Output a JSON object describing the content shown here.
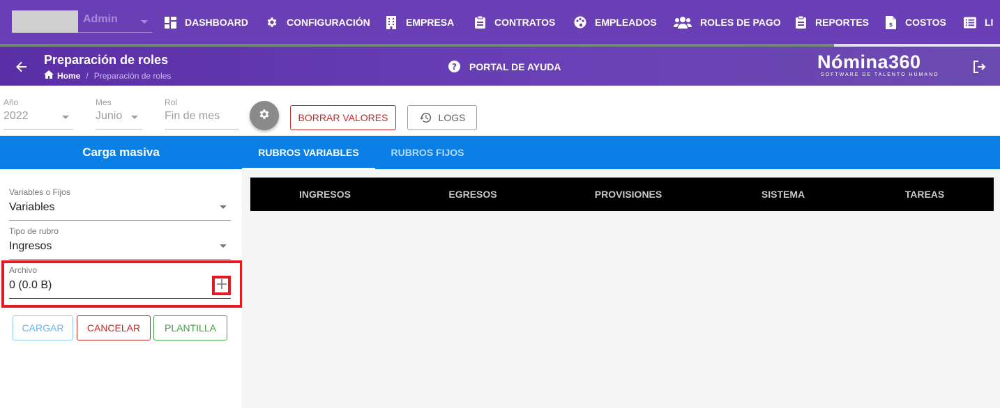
{
  "topnav": {
    "user_label": "Admin",
    "items": [
      {
        "label": "DASHBOARD",
        "icon": "dashboard-icon"
      },
      {
        "label": "CONFIGURACIÓN",
        "icon": "gear-icon"
      },
      {
        "label": "EMPRESA",
        "icon": "building-icon"
      },
      {
        "label": "CONTRATOS",
        "icon": "clipboard-icon"
      },
      {
        "label": "EMPLEADOS",
        "icon": "palette-icon"
      },
      {
        "label": "ROLES DE PAGO",
        "icon": "users-icon"
      },
      {
        "label": "REPORTES",
        "icon": "clipboard-icon"
      },
      {
        "label": "COSTOS",
        "icon": "file-invoice-icon"
      },
      {
        "label": "LI",
        "icon": "list-icon"
      }
    ]
  },
  "header": {
    "title": "Preparación de roles",
    "breadcrumb": {
      "home": "Home",
      "current": "Preparación de roles"
    },
    "help_label": "PORTAL DE AYUDA",
    "brand_name": "Nómina360",
    "brand_tagline": "SOFTWARE DE TALENTO HUMANO"
  },
  "filters": {
    "anio": {
      "label": "Año",
      "value": "2022"
    },
    "mes": {
      "label": "Mes",
      "value": "Junio"
    },
    "rol": {
      "label": "Rol",
      "value": "Fin de mes"
    }
  },
  "toolbar": {
    "borrar_label": "BORRAR VALORES",
    "logs_label": "LOGS"
  },
  "left_panel": {
    "title": "Carga masiva",
    "variables_fijos": {
      "label": "Variables o Fijos",
      "value": "Variables"
    },
    "tipo_rubro": {
      "label": "Tipo de rubro",
      "value": "Ingresos"
    },
    "archivo": {
      "label": "Archivo",
      "value": "0 (0.0 B)"
    },
    "buttons": {
      "cargar": "CARGAR",
      "cancelar": "CANCELAR",
      "plantilla": "PLANTILLA"
    }
  },
  "tabs": [
    {
      "label": "RUBROS VARIABLES",
      "active": true
    },
    {
      "label": "RUBROS FIJOS",
      "active": false
    }
  ],
  "subtabs": [
    "INGRESOS",
    "EGRESOS",
    "PROVISIONES",
    "SISTEMA",
    "TAREAS"
  ],
  "colors": {
    "nav": "#6a3fb6",
    "primary_blue": "#0a7fe6",
    "danger": "#c62828",
    "success": "#43a047",
    "highlight_red": "#e21b23"
  }
}
